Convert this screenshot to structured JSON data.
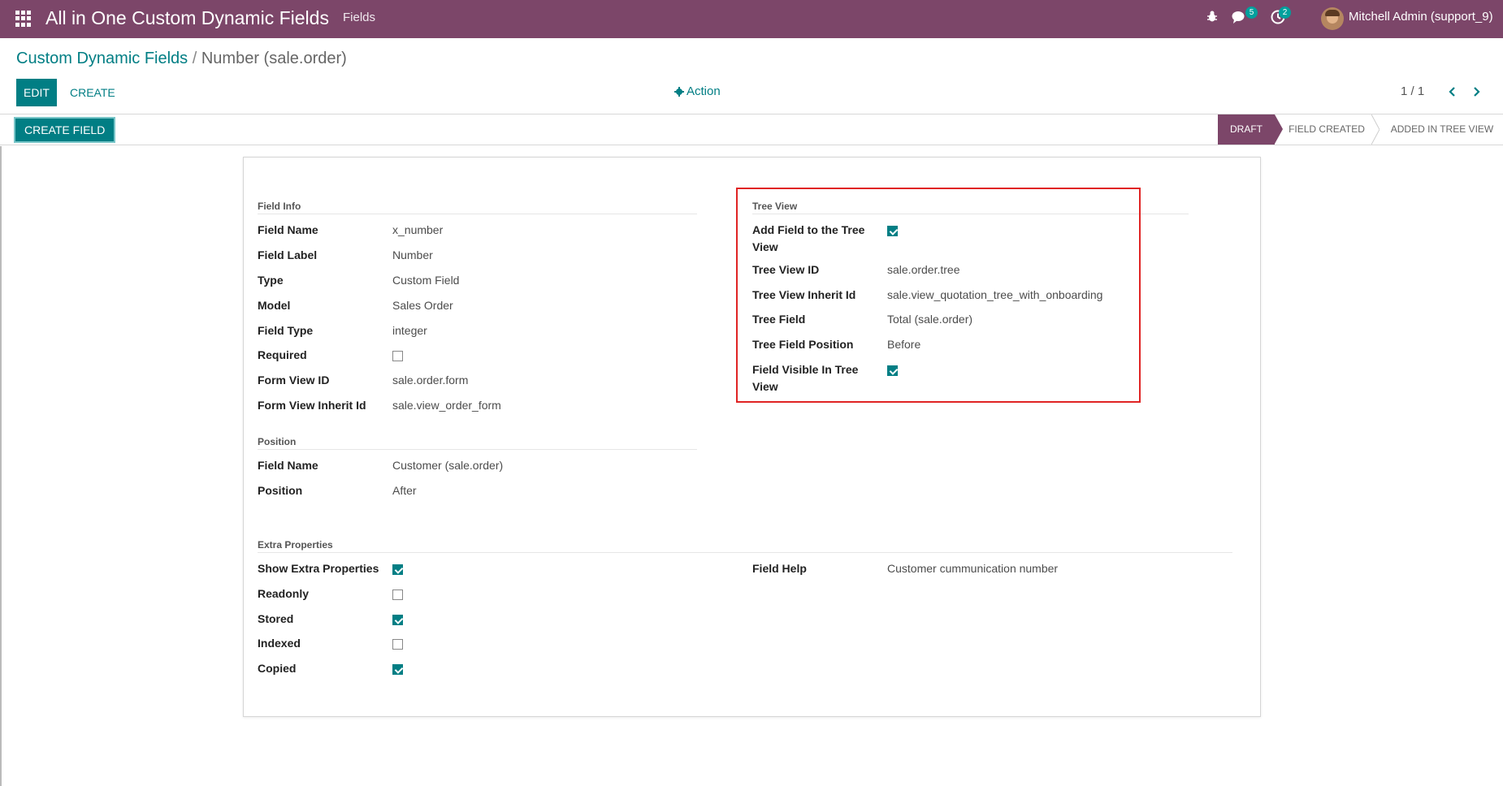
{
  "navbar": {
    "app_title": "All in One Custom Dynamic Fields",
    "menu_fields": "Fields",
    "chat_badge": "5",
    "activity_badge": "2",
    "user_name": "Mitchell Admin (support_9)"
  },
  "breadcrumb": {
    "parent": "Custom Dynamic Fields",
    "separator": "/",
    "current": "Number (sale.order)"
  },
  "buttons": {
    "edit": "EDIT",
    "create": "CREATE",
    "action": "Action",
    "create_field": "CREATE FIELD"
  },
  "pager": {
    "value": "1 / 1"
  },
  "statusbar": {
    "stages": [
      "DRAFT",
      "FIELD CREATED",
      "ADDED IN TREE VIEW"
    ],
    "active": "DRAFT"
  },
  "field_info": {
    "title": "Field Info",
    "rows": [
      {
        "label": "Field Name",
        "value": "x_number"
      },
      {
        "label": "Field Label",
        "value": "Number"
      },
      {
        "label": "Type",
        "value": "Custom Field"
      },
      {
        "label": "Model",
        "value": "Sales Order"
      },
      {
        "label": "Field Type",
        "value": "integer"
      },
      {
        "label": "Required",
        "checked": false
      },
      {
        "label": "Form View ID",
        "value": "sale.order.form"
      },
      {
        "label": "Form View Inherit Id",
        "value": "sale.view_order_form"
      }
    ]
  },
  "position": {
    "title": "Position",
    "rows": [
      {
        "label": "Field Name",
        "value": "Customer (sale.order)"
      },
      {
        "label": "Position",
        "value": "After"
      }
    ]
  },
  "tree_view": {
    "title": "Tree View",
    "add_field_label_line1": "Add Field to the Tree",
    "add_field_label_line2": "View",
    "add_field_checked": true,
    "tree_view_id_label": "Tree View ID",
    "tree_view_id": "sale.order.tree",
    "inherit_label": "Tree View Inherit Id",
    "inherit_value": "sale.view_quotation_tree_with_onboarding",
    "tree_field_label": "Tree Field",
    "tree_field_value": "Total (sale.order)",
    "position_label": "Tree Field Position",
    "position_value": "Before",
    "visible_label_line1": "Field Visible In Tree",
    "visible_label_line2": "View",
    "visible_checked": true
  },
  "extra": {
    "title": "Extra Properties",
    "rows": [
      {
        "label": "Show Extra Properties",
        "checked": true
      },
      {
        "label": "Readonly",
        "checked": false
      },
      {
        "label": "Stored",
        "checked": true
      },
      {
        "label": "Indexed",
        "checked": false
      },
      {
        "label": "Copied",
        "checked": true
      }
    ],
    "help_label": "Field Help",
    "help_value": "Customer cummunication number"
  },
  "colors": {
    "navbar": "#7c4669",
    "primary": "#017e84",
    "highlight": "#e02424"
  }
}
